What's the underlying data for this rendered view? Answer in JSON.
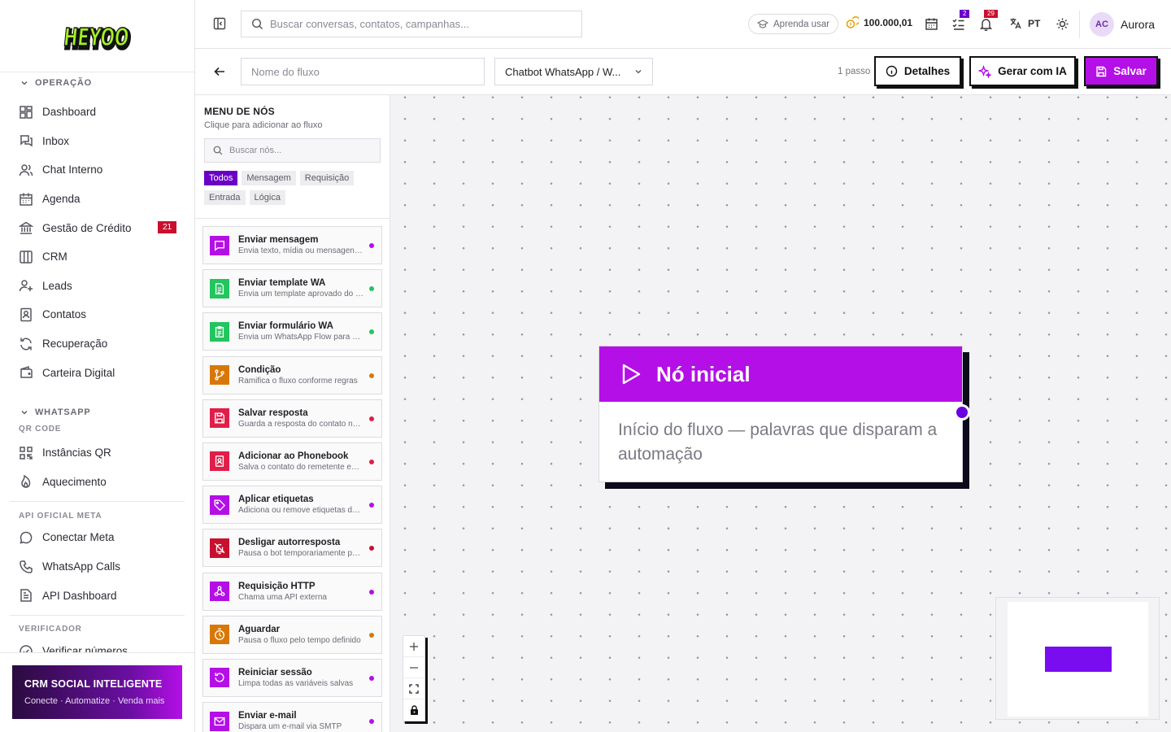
{
  "app": {
    "logo_text": "HEYOO"
  },
  "sidebar": {
    "sections": [
      {
        "title": "OPERAÇÃO",
        "items": [
          {
            "label": "Dashboard",
            "icon": "dashboard-icon"
          },
          {
            "label": "Inbox",
            "icon": "inbox-icon"
          },
          {
            "label": "Chat Interno",
            "icon": "users-icon"
          },
          {
            "label": "Agenda",
            "icon": "calendar-icon"
          },
          {
            "label": "Gestão de Crédito",
            "icon": "bank-icon",
            "badge": "21"
          },
          {
            "label": "CRM",
            "icon": "columns-icon"
          },
          {
            "label": "Leads",
            "icon": "user-plus-icon"
          },
          {
            "label": "Contatos",
            "icon": "contact-book-icon"
          },
          {
            "label": "Recuperação",
            "icon": "refresh-icon"
          },
          {
            "label": "Carteira Digital",
            "icon": "wallet-icon"
          }
        ]
      },
      {
        "title": "WHATSAPP",
        "sub": "QR CODE",
        "items": [
          {
            "label": "Instâncias QR",
            "icon": "qr-code-icon"
          },
          {
            "label": "Aquecimento",
            "icon": "flame-icon"
          }
        ]
      },
      {
        "title": "API OFICIAL META",
        "items": [
          {
            "label": "Conectar Meta",
            "icon": "chat-icon"
          },
          {
            "label": "WhatsApp Calls",
            "icon": "phone-icon"
          },
          {
            "label": "API Dashboard",
            "icon": "report-icon"
          }
        ]
      },
      {
        "title": "VERIFICADOR",
        "items": [
          {
            "label": "Verificar números",
            "icon": "check-circle-icon"
          }
        ]
      }
    ],
    "promo": {
      "title": "CRM SOCIAL INTELIGENTE",
      "subtitle": "Conecte · Automatize · Venda mais"
    }
  },
  "header": {
    "search_placeholder": "Buscar conversas, contatos, campanhas...",
    "learn_label": "Aprenda usar",
    "credits": "100.000,01",
    "tasks_badge": "2",
    "notifications_badge": "29",
    "language": "PT",
    "user_initials": "AC",
    "user_name": "Aurora"
  },
  "flowbar": {
    "name_placeholder": "Nome do fluxo",
    "type_value": "Chatbot WhatsApp / W...",
    "steps": "1 passo",
    "details_label": "Detalhes",
    "ai_label": "Gerar com IA",
    "save_label": "Salvar"
  },
  "menu": {
    "title": "MENU DE NÓS",
    "subtitle": "Clique para adicionar ao fluxo",
    "search_placeholder": "Buscar nós...",
    "filters": [
      "Todos",
      "Mensagem",
      "Requisição",
      "Entrada",
      "Lógica"
    ],
    "active_filter": "Todos",
    "nodes": [
      {
        "name": "Enviar mensagem",
        "desc": "Envia texto, mídia ou mensagens interativas",
        "color": "#b40fe6",
        "dot": "#b40fe6",
        "icon": "message-icon"
      },
      {
        "name": "Enviar template WA",
        "desc": "Envia um template aprovado do WhatsApp",
        "color": "#22c55e",
        "dot": "#22c55e",
        "icon": "document-icon"
      },
      {
        "name": "Enviar formulário WA",
        "desc": "Envia um WhatsApp Flow para coleta",
        "color": "#22c55e",
        "dot": "#22c55e",
        "icon": "clipboard-icon"
      },
      {
        "name": "Condição",
        "desc": "Ramifica o fluxo conforme regras",
        "color": "#d97706",
        "dot": "#d97706",
        "icon": "branch-icon"
      },
      {
        "name": "Salvar resposta",
        "desc": "Guarda a resposta do contato numa variável",
        "color": "#e11d48",
        "dot": "#e11d48",
        "icon": "save-icon"
      },
      {
        "name": "Adicionar ao Phonebook",
        "desc": "Salva o contato do remetente em uma lista",
        "color": "#e11d48",
        "dot": "#e11d48",
        "icon": "contact-book-icon"
      },
      {
        "name": "Aplicar etiquetas",
        "desc": "Adiciona ou remove etiquetas das conversas",
        "color": "#b40fe6",
        "dot": "#b40fe6",
        "icon": "tag-icon"
      },
      {
        "name": "Desligar autorresposta",
        "desc": "Pausa o bot temporariamente para o contato",
        "color": "#c8102e",
        "dot": "#c8102e",
        "icon": "bell-off-icon"
      },
      {
        "name": "Requisição HTTP",
        "desc": "Chama uma API externa",
        "color": "#b40fe6",
        "dot": "#b40fe6",
        "icon": "webhook-icon"
      },
      {
        "name": "Aguardar",
        "desc": "Pausa o fluxo pelo tempo definido",
        "color": "#d97706",
        "dot": "#d97706",
        "icon": "timer-icon"
      },
      {
        "name": "Reiniciar sessão",
        "desc": "Limpa todas as variáveis salvas",
        "color": "#b40fe6",
        "dot": "#b40fe6",
        "icon": "restart-icon"
      },
      {
        "name": "Enviar e-mail",
        "desc": "Dispara um e-mail via SMTP",
        "color": "#b40fe6",
        "dot": "#b40fe6",
        "icon": "mail-icon"
      }
    ]
  },
  "canvas": {
    "start_node": {
      "title": "Nó inicial",
      "body": "Início do fluxo — palavras que disparam a automação"
    }
  }
}
